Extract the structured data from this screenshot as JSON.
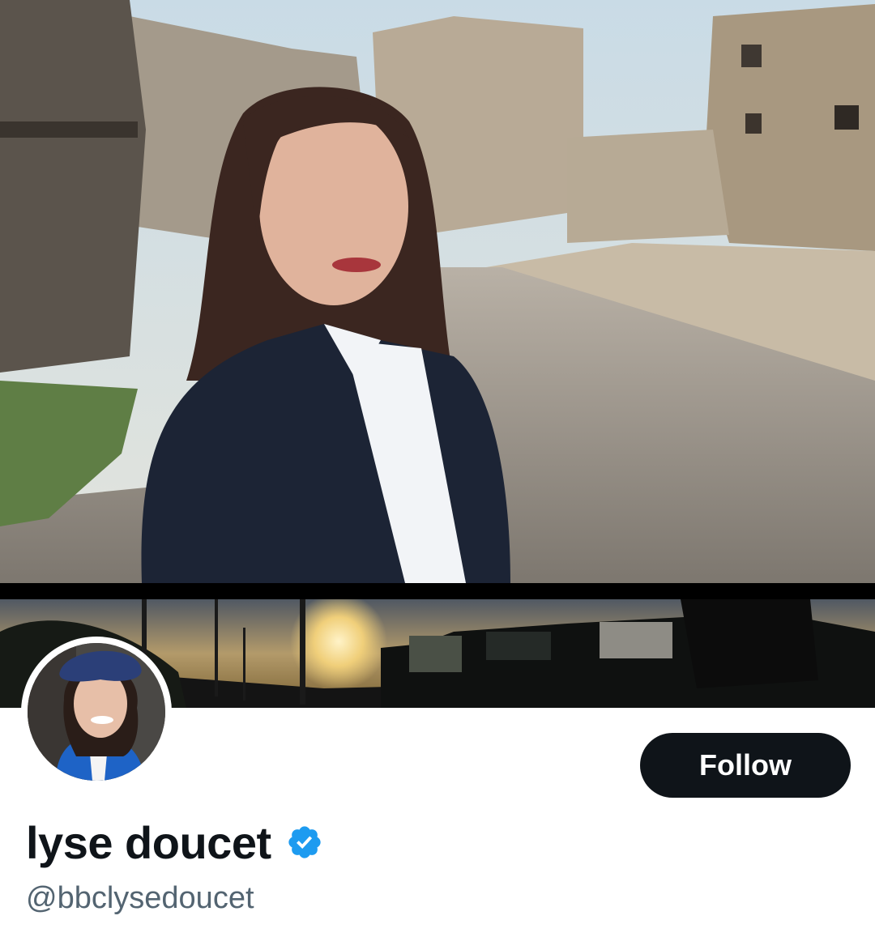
{
  "profile": {
    "display_name": "lyse doucet",
    "handle": "@bbclysedoucet",
    "verified": true,
    "verified_icon": "verified-badge-icon",
    "follow_label": "Follow"
  },
  "colors": {
    "follow_button_bg": "#0f1419",
    "follow_button_text": "#ffffff",
    "name_text": "#0f1419",
    "handle_text": "#536471",
    "verified_badge": "#1d9bf0"
  }
}
